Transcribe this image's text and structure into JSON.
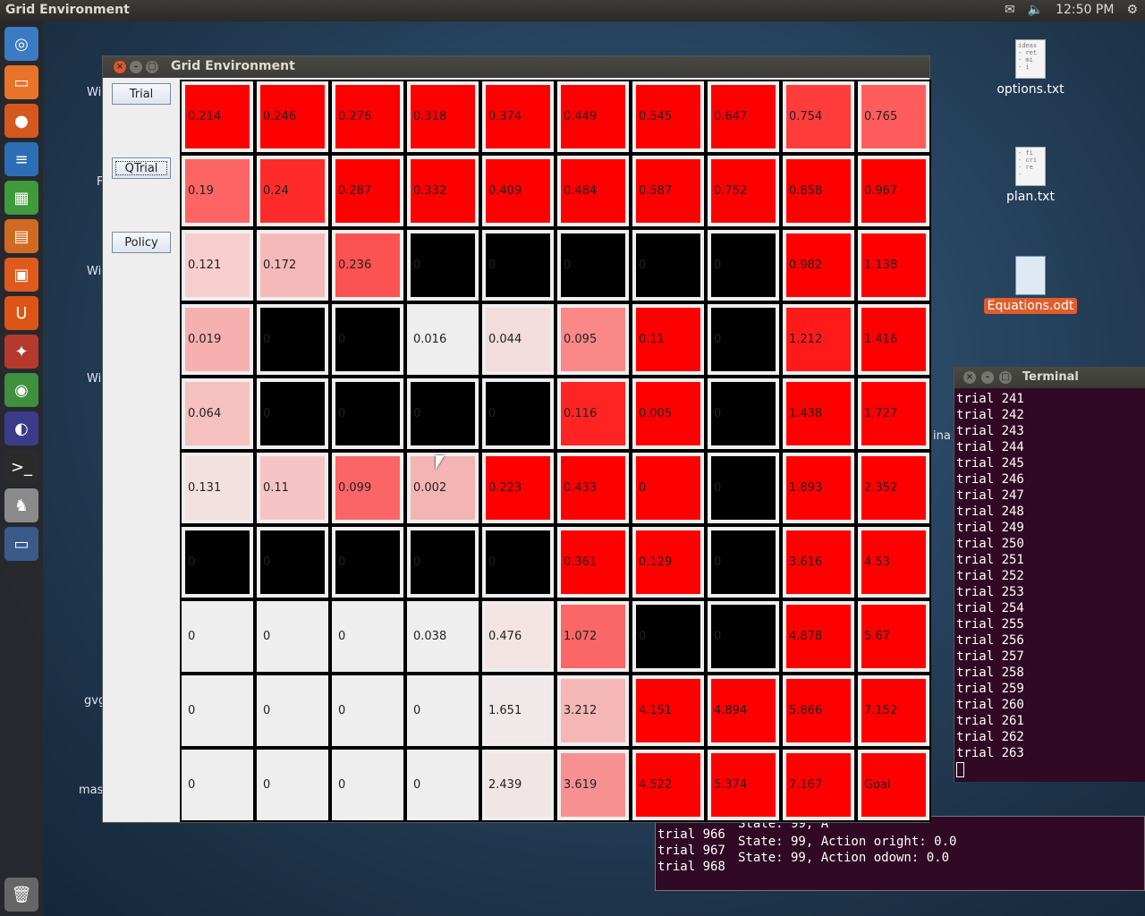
{
  "topbar": {
    "title": "Grid Environment",
    "time": "12:50 PM"
  },
  "desktop": {
    "icons": [
      {
        "label": "options.txt",
        "lines": "ideas\n- ret\n- mi\n- i"
      },
      {
        "label": "plan.txt",
        "lines": "- fi\n- cri\n- re\n- "
      },
      {
        "label": "Equations.odt",
        "lines": ""
      }
    ],
    "edge_labels": [
      "Wi",
      "F",
      "Wi",
      "Wi",
      "gvg",
      "mas"
    ]
  },
  "window": {
    "title": "Grid Environment",
    "buttons": [
      "Trial",
      "QTrial",
      "Policy"
    ]
  },
  "grid": {
    "rows": [
      [
        {
          "v": "0.214",
          "c": "#ff0000"
        },
        {
          "v": "0.246",
          "c": "#ff0000"
        },
        {
          "v": "0.276",
          "c": "#ff0000"
        },
        {
          "v": "0.318",
          "c": "#ff0000"
        },
        {
          "v": "0.374",
          "c": "#ff0000"
        },
        {
          "v": "0.449",
          "c": "#ff0000"
        },
        {
          "v": "0.545",
          "c": "#ff0000"
        },
        {
          "v": "0.647",
          "c": "#ff0000"
        },
        {
          "v": "0.754",
          "c": "#ff3b3b"
        },
        {
          "v": "0.765",
          "c": "#ff5d5d"
        }
      ],
      [
        {
          "v": "0.19",
          "c": "#fd6464"
        },
        {
          "v": "0.24",
          "c": "#ff2b2b"
        },
        {
          "v": "0.287",
          "c": "#ff0000"
        },
        {
          "v": "0.332",
          "c": "#ff0000"
        },
        {
          "v": "0.409",
          "c": "#ff0000"
        },
        {
          "v": "0.484",
          "c": "#ff0000"
        },
        {
          "v": "0.587",
          "c": "#ff0000"
        },
        {
          "v": "0.752",
          "c": "#ff0000"
        },
        {
          "v": "0.858",
          "c": "#ff0000"
        },
        {
          "v": "0.967",
          "c": "#ff0000"
        }
      ],
      [
        {
          "v": "0.121",
          "c": "#f7cece"
        },
        {
          "v": "0.172",
          "c": "#f6b9b9"
        },
        {
          "v": "0.236",
          "c": "#fd5252"
        },
        {
          "v": "0",
          "c": "#000000"
        },
        {
          "v": "0",
          "c": "#000000"
        },
        {
          "v": "0",
          "c": "#000000"
        },
        {
          "v": "0",
          "c": "#000000"
        },
        {
          "v": "0",
          "c": "#000000"
        },
        {
          "v": "0.982",
          "c": "#ff0000"
        },
        {
          "v": "1.138",
          "c": "#ff0000"
        }
      ],
      [
        {
          "v": "0.019",
          "c": "#f6b0b0"
        },
        {
          "v": "0",
          "c": "#000000"
        },
        {
          "v": "0",
          "c": "#000000"
        },
        {
          "v": "0.016",
          "c": "#eeeeee"
        },
        {
          "v": "0.044",
          "c": "#f3dcdc"
        },
        {
          "v": "0.095",
          "c": "#fa8888"
        },
        {
          "v": "0.11",
          "c": "#ff0000"
        },
        {
          "v": "0",
          "c": "#000000"
        },
        {
          "v": "1.212",
          "c": "#ff1a1a"
        },
        {
          "v": "1.416",
          "c": "#ff0000"
        }
      ],
      [
        {
          "v": "0.064",
          "c": "#f6c0c0"
        },
        {
          "v": "0",
          "c": "#000000"
        },
        {
          "v": "0",
          "c": "#000000"
        },
        {
          "v": "0",
          "c": "#000000"
        },
        {
          "v": "0",
          "c": "#000000"
        },
        {
          "v": "0.116",
          "c": "#ff2424"
        },
        {
          "v": "0.005",
          "c": "#ff0000"
        },
        {
          "v": "0",
          "c": "#000000"
        },
        {
          "v": "1.438",
          "c": "#ff0000"
        },
        {
          "v": "1.727",
          "c": "#ff0000"
        }
      ],
      [
        {
          "v": "0.131",
          "c": "#f3e1e1"
        },
        {
          "v": "0.11",
          "c": "#f6c4c4"
        },
        {
          "v": "0.099",
          "c": "#fc6565"
        },
        {
          "v": "0.002",
          "c": "#f4b4b4"
        },
        {
          "v": "0.223",
          "c": "#ff0000"
        },
        {
          "v": "0.433",
          "c": "#ff0000"
        },
        {
          "v": "0",
          "c": "#ff0000"
        },
        {
          "v": "0",
          "c": "#000000"
        },
        {
          "v": "1.893",
          "c": "#ff0000"
        },
        {
          "v": "2.352",
          "c": "#ff0000"
        }
      ],
      [
        {
          "v": "0",
          "c": "#000000"
        },
        {
          "v": "0",
          "c": "#000000"
        },
        {
          "v": "0",
          "c": "#000000"
        },
        {
          "v": "0",
          "c": "#000000"
        },
        {
          "v": "0",
          "c": "#000000"
        },
        {
          "v": "0.361",
          "c": "#ff0000"
        },
        {
          "v": "0.129",
          "c": "#ff0000"
        },
        {
          "v": "0",
          "c": "#000000"
        },
        {
          "v": "3.616",
          "c": "#ff0000"
        },
        {
          "v": "4.53",
          "c": "#ff0000"
        }
      ],
      [
        {
          "v": "0",
          "c": "#eeeeee"
        },
        {
          "v": "0",
          "c": "#eeeeee"
        },
        {
          "v": "0",
          "c": "#eeeeee"
        },
        {
          "v": "0.038",
          "c": "#eeeeee"
        },
        {
          "v": "0.476",
          "c": "#f3e3e3"
        },
        {
          "v": "1.072",
          "c": "#fb6666"
        },
        {
          "v": "0",
          "c": "#000000"
        },
        {
          "v": "0",
          "c": "#000000"
        },
        {
          "v": "4.878",
          "c": "#ff0000"
        },
        {
          "v": "5.67",
          "c": "#ff0000"
        }
      ],
      [
        {
          "v": "0",
          "c": "#eeeeee"
        },
        {
          "v": "0",
          "c": "#eeeeee"
        },
        {
          "v": "0",
          "c": "#eeeeee"
        },
        {
          "v": "0",
          "c": "#eeeeee"
        },
        {
          "v": "1.651",
          "c": "#f1e9e9"
        },
        {
          "v": "3.212",
          "c": "#f5b6b6"
        },
        {
          "v": "4.151",
          "c": "#ff0000"
        },
        {
          "v": "4.894",
          "c": "#ff0000"
        },
        {
          "v": "5.866",
          "c": "#ff0000"
        },
        {
          "v": "7.152",
          "c": "#ff0000"
        }
      ],
      [
        {
          "v": "0",
          "c": "#eeeeee"
        },
        {
          "v": "0",
          "c": "#eeeeee"
        },
        {
          "v": "0",
          "c": "#eeeeee"
        },
        {
          "v": "0",
          "c": "#eeeeee"
        },
        {
          "v": "2.439",
          "c": "#f1e6e6"
        },
        {
          "v": "3.619",
          "c": "#f79191"
        },
        {
          "v": "4.522",
          "c": "#ff0000"
        },
        {
          "v": "5.374",
          "c": "#ff0000"
        },
        {
          "v": "7.167",
          "c": "#ff0000"
        },
        {
          "v": "Goal",
          "c": "#ff0000"
        }
      ]
    ]
  },
  "terminal": {
    "title": "Terminal",
    "lines": [
      "trial 241",
      "trial 242",
      "trial 243",
      "trial 244",
      "trial 245",
      "trial 246",
      "trial 247",
      "trial 248",
      "trial 249",
      "trial 250",
      "trial 251",
      "trial 252",
      "trial 253",
      "trial 254",
      "trial 255",
      "trial 256",
      "trial 257",
      "trial 258",
      "trial 259",
      "trial 260",
      "trial 261",
      "trial 262",
      "trial 263"
    ]
  },
  "terminal2": {
    "left": [
      "trial 966",
      "trial 967",
      "trial 968"
    ],
    "right": [
      "State: 99, A",
      "State: 99, Action oright: 0.0",
      "State: 99, Action odown: 0.0"
    ]
  },
  "peek_label": "ina"
}
